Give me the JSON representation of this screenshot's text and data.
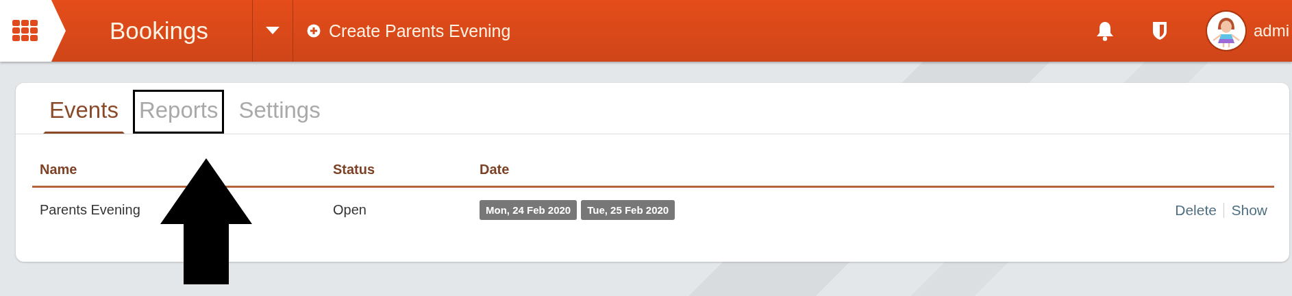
{
  "header": {
    "title": "Bookings",
    "create_button": "Create Parents Evening",
    "user": "admi"
  },
  "tabs": [
    {
      "label": "Events",
      "selected": true,
      "annotated": false
    },
    {
      "label": "Reports",
      "selected": false,
      "annotated": true
    },
    {
      "label": "Settings",
      "selected": false,
      "annotated": false
    }
  ],
  "table": {
    "columns": [
      "Name",
      "Status",
      "Date"
    ],
    "rows": [
      {
        "name": "Parents Evening",
        "status": "Open",
        "dates": [
          "Mon, 24 Feb 2020",
          "Tue, 25 Feb 2020"
        ],
        "actions": [
          "Delete",
          "Show"
        ]
      }
    ]
  }
}
